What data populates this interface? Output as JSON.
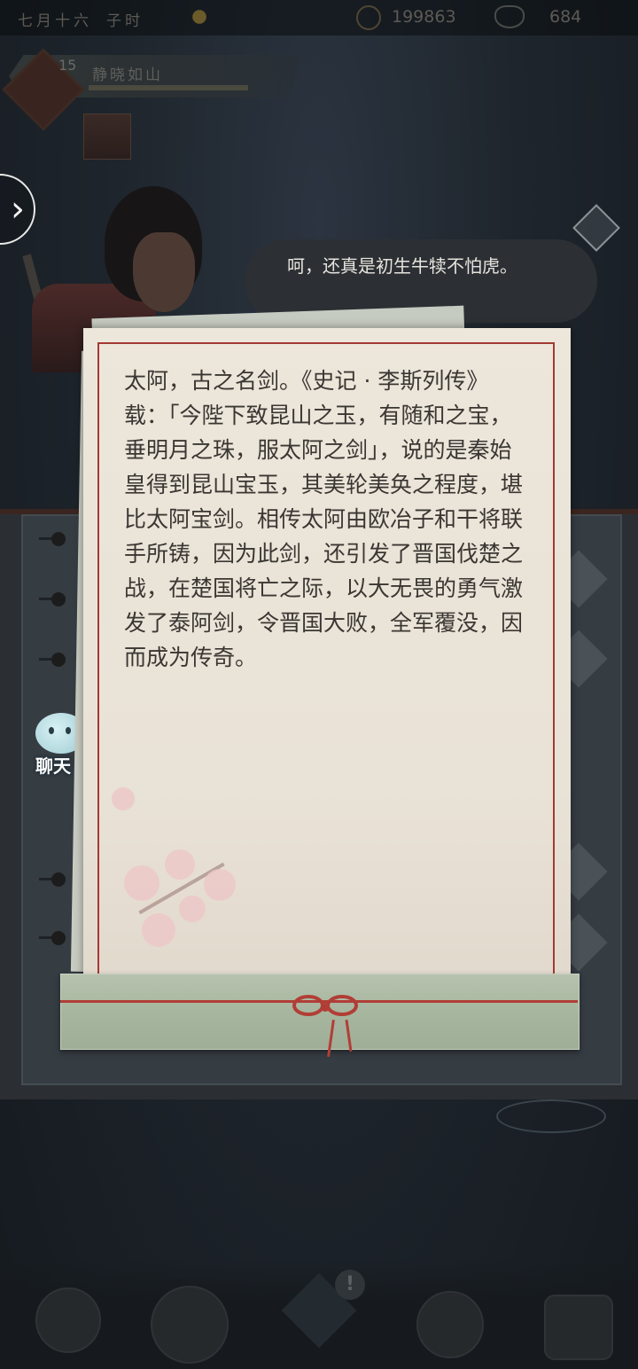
{
  "top_bar": {
    "date": "七月十六",
    "time": "子时",
    "coins": "199863",
    "ingots": "684"
  },
  "player": {
    "level": "15",
    "name": "静晓如山"
  },
  "npc_speech": "呵，还真是初生牛犊不怕虎。",
  "scroll": {
    "text": "太阿，古之名剑。《史记 · 李斯列传》载：「今陛下致昆山之玉，有随和之宝，垂明月之珠，服太阿之剑」，说的是秦始皇得到昆山宝玉，其美轮美奂之程度，堪比太阿宝剑。相传太阿由欧冶子和干将联手所铸，因为此剑，还引发了晋国伐楚之战，在楚国将亡之际，以大无畏的勇气激发了泰阿剑，令晋国大败，全军覆没，因而成为传奇。"
  },
  "chat_button": {
    "label": "聊天"
  },
  "notification_badge": "!",
  "colors": {
    "paper": "#ece6db",
    "border_red": "#a23a32",
    "roller_green": "#a7b69f",
    "background_dark": "#1b2126"
  },
  "icons": [
    "sun-icon",
    "coin-icon",
    "ingot-icon",
    "chevron-right-icon",
    "diamond-icon",
    "chat-icon",
    "bow-icon"
  ]
}
